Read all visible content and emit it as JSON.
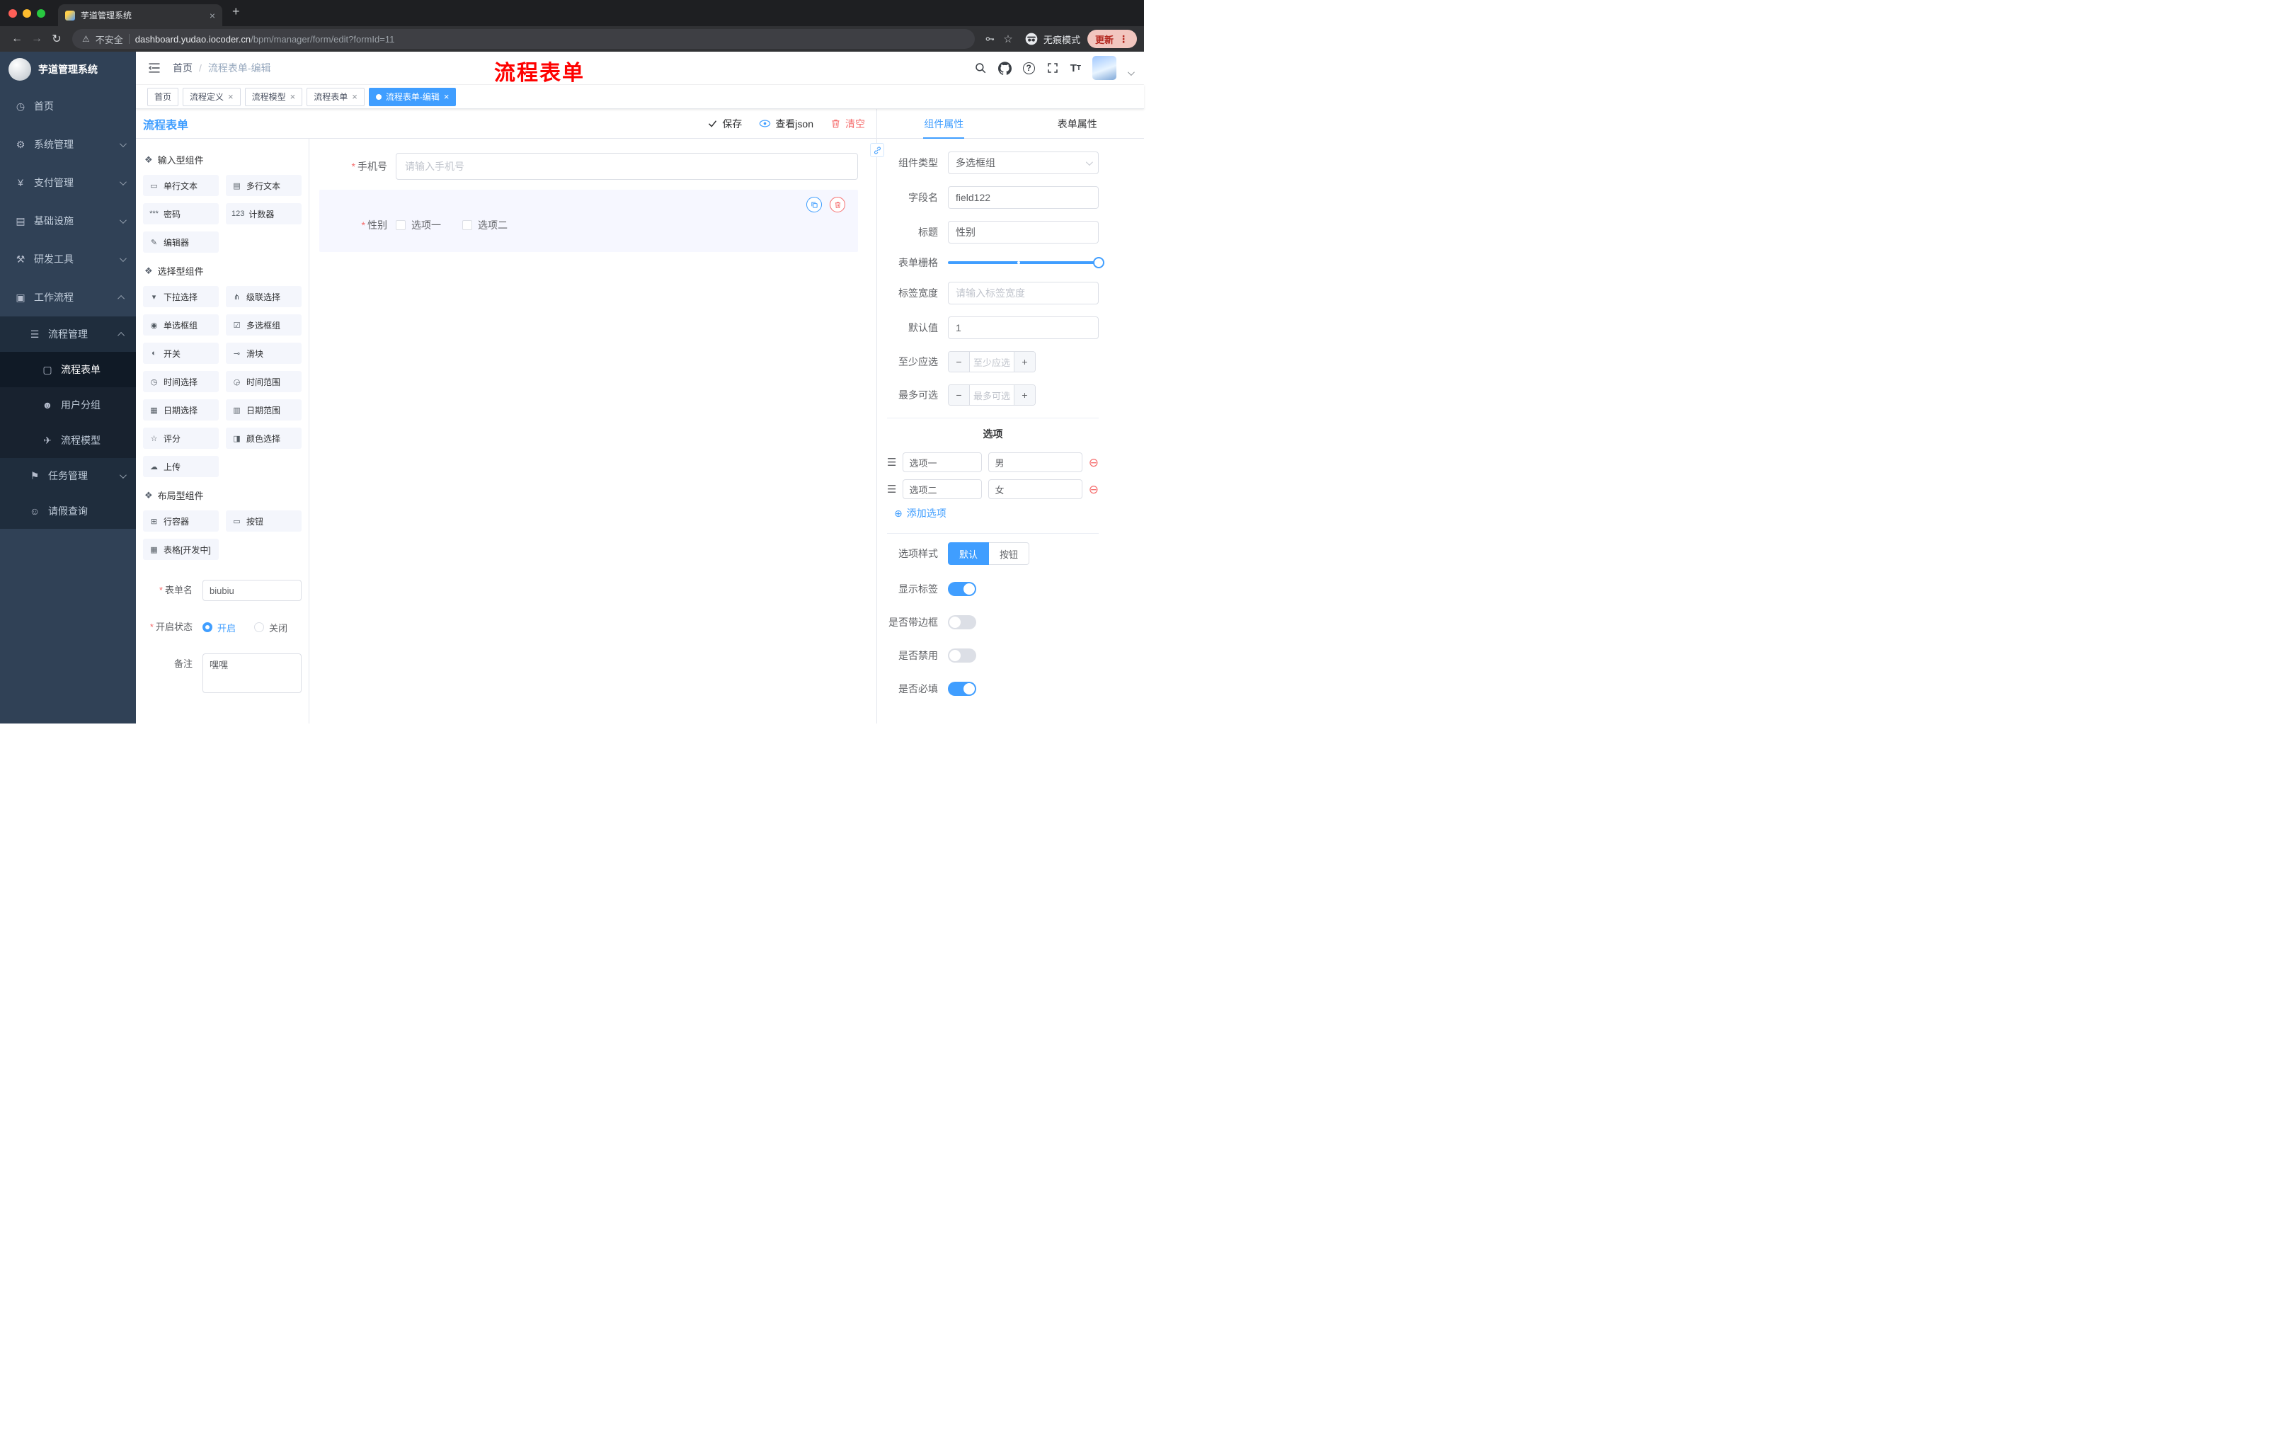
{
  "browser": {
    "tab_title": "芋道管理系统",
    "security_label": "不安全",
    "url_domain": "dashboard.yudao.iocoder.cn",
    "url_path": "/bpm/manager/form/edit?formId=11",
    "incognito_label": "无痕模式",
    "update_label": "更新"
  },
  "annotation": {
    "text": "流程表单"
  },
  "sidebar": {
    "logo_title": "芋道管理系统",
    "items": [
      {
        "label": "首页",
        "icon": "◷"
      },
      {
        "label": "系统管理",
        "icon": "⚙"
      },
      {
        "label": "支付管理",
        "icon": "¥"
      },
      {
        "label": "基础设施",
        "icon": "▤"
      },
      {
        "label": "研发工具",
        "icon": "⚒"
      },
      {
        "label": "工作流程",
        "icon": "▣"
      },
      {
        "label": "流程管理",
        "icon": "☰"
      },
      {
        "label": "流程表单",
        "icon": "▢"
      },
      {
        "label": "用户分组",
        "icon": "☻"
      },
      {
        "label": "流程模型",
        "icon": "✈"
      },
      {
        "label": "任务管理",
        "icon": "⚑"
      },
      {
        "label": "请假查询",
        "icon": "☺"
      }
    ]
  },
  "header": {
    "breadcrumb_home": "首页",
    "breadcrumb_sep": "/",
    "breadcrumb_current": "流程表单-编辑"
  },
  "tags": [
    {
      "label": "首页"
    },
    {
      "label": "流程定义"
    },
    {
      "label": "流程模型"
    },
    {
      "label": "流程表单"
    },
    {
      "label": "流程表单-编辑"
    }
  ],
  "designer": {
    "title": "流程表单",
    "actions": {
      "save": "保存",
      "view_json": "查看json",
      "clear": "清空"
    }
  },
  "palette": {
    "groups": [
      {
        "title": "输入型组件",
        "items": [
          {
            "label": "单行文本",
            "icon": "▭"
          },
          {
            "label": "多行文本",
            "icon": "▤"
          },
          {
            "label": "密码",
            "icon": "***"
          },
          {
            "label": "计数器",
            "icon": "123"
          },
          {
            "label": "编辑器",
            "icon": "✎"
          }
        ]
      },
      {
        "title": "选择型组件",
        "items": [
          {
            "label": "下拉选择",
            "icon": "▾"
          },
          {
            "label": "级联选择",
            "icon": "⋔"
          },
          {
            "label": "单选框组",
            "icon": "◉"
          },
          {
            "label": "多选框组",
            "icon": "☑"
          },
          {
            "label": "开关",
            "icon": "◐"
          },
          {
            "label": "滑块",
            "icon": "⊸"
          },
          {
            "label": "时间选择",
            "icon": "◷"
          },
          {
            "label": "时间范围",
            "icon": "◶"
          },
          {
            "label": "日期选择",
            "icon": "▦"
          },
          {
            "label": "日期范围",
            "icon": "▥"
          },
          {
            "label": "评分",
            "icon": "☆"
          },
          {
            "label": "颜色选择",
            "icon": "◨"
          },
          {
            "label": "上传",
            "icon": "☁"
          }
        ]
      },
      {
        "title": "布局型组件",
        "items": [
          {
            "label": "行容器",
            "icon": "⊞"
          },
          {
            "label": "按钮",
            "icon": "▭"
          },
          {
            "label": "表格[开发中]",
            "icon": "▦"
          }
        ]
      }
    ]
  },
  "form_config": {
    "name_label": "表单名",
    "name_value": "biubiu",
    "status_label": "开启状态",
    "status_on": "开启",
    "status_off": "关闭",
    "remark_label": "备注",
    "remark_value": "嘿嘿"
  },
  "canvas": {
    "phone_label": "手机号",
    "phone_placeholder": "请输入手机号",
    "gender_label": "性别",
    "gender_options": [
      "选项一",
      "选项二"
    ]
  },
  "props": {
    "tab_component": "组件属性",
    "tab_form": "表单属性",
    "component_type_label": "组件类型",
    "component_type_value": "多选框组",
    "field_name_label": "字段名",
    "field_name_value": "field122",
    "title_label": "标题",
    "title_value": "性别",
    "grid_label": "表单栅格",
    "label_width_label": "标签宽度",
    "label_width_placeholder": "请输入标签宽度",
    "default_label": "默认值",
    "default_value": "1",
    "min_label": "至少应选",
    "min_placeholder": "至少应选",
    "max_label": "最多可选",
    "max_placeholder": "最多可选",
    "options_title": "选项",
    "options": [
      {
        "label": "选项一",
        "value": "男"
      },
      {
        "label": "选项二",
        "value": "女"
      }
    ],
    "add_option": "添加选项",
    "style_label": "选项样式",
    "style_default": "默认",
    "style_button": "按钮",
    "switches": [
      {
        "label": "显示标签",
        "on": true
      },
      {
        "label": "是否带边框",
        "on": false
      },
      {
        "label": "是否禁用",
        "on": false
      },
      {
        "label": "是否必填",
        "on": true
      }
    ]
  }
}
